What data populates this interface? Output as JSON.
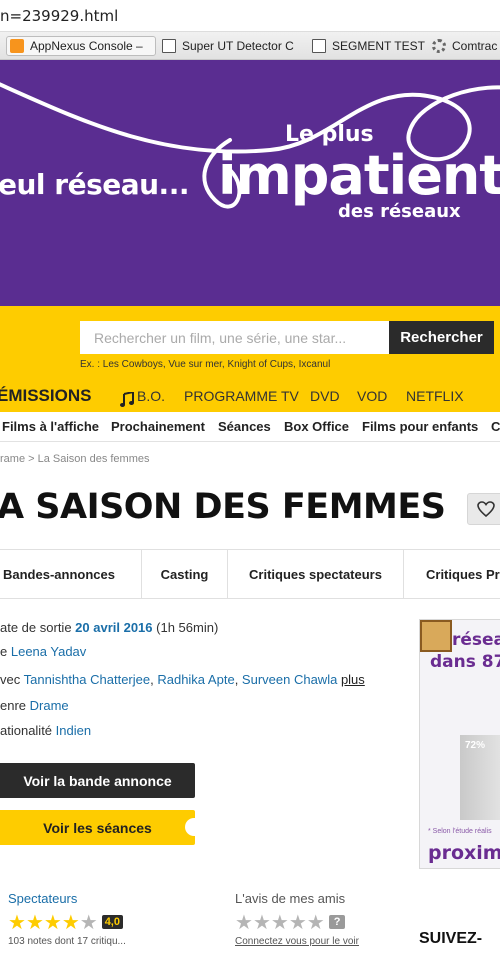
{
  "browser": {
    "url": "n=239929.html",
    "bookmarks": [
      "AppNexus Console –",
      "Super UT Detector C",
      "SEGMENT TEST",
      "Comtrac"
    ]
  },
  "banner": {
    "left_text": "eul réseau...",
    "le_plus": "Le plus",
    "big_word": "impatient",
    "small_text": "des réseaux"
  },
  "search": {
    "placeholder": "Rechercher un film, une série, une star...",
    "button": "Rechercher",
    "examples": "Ex. : Les Cowboys, Vue sur mer, Knight of Cups, Ixcanul"
  },
  "main_nav": [
    "ÉMISSIONS",
    "B.O.",
    "PROGRAMME TV",
    "DVD",
    "VOD",
    "NETFLIX"
  ],
  "sub_nav": [
    "Films à l'affiche",
    "Prochainement",
    "Séances",
    "Box Office",
    "Films pour enfants",
    "C"
  ],
  "breadcrumb": "rame >  La Saison des femmes",
  "movie": {
    "title": "A SAISON DES FEMMES",
    "tabs": [
      "Bandes-annonces",
      "Casting",
      "Critiques spectateurs",
      "Critiques Pr"
    ],
    "release_label": "ate de sortie",
    "release_date": "20 avril 2016",
    "duration": "(1h 56min)",
    "director_label": "e",
    "director": "Leena Yadav",
    "cast_label": "vec",
    "cast": [
      "Tannishtha Chatterjee",
      "Radhika Apte",
      "Surveen Chawla"
    ],
    "cast_more": "plus",
    "genre_label": "enre",
    "genre": "Drame",
    "nationality_label": "ationalité",
    "nationality": "Indien",
    "trailer_button": "Voir la bande annonce",
    "showtimes_button": "Voir les séances"
  },
  "ad": {
    "line1": "réseau",
    "line2": "dans 87%",
    "percent": "72%",
    "note": "* Selon l'étude réalis",
    "brand": "proxim"
  },
  "ratings": {
    "spectators_title": "Spectateurs",
    "spectators_score": "4,0",
    "spectators_stars": 4,
    "spectators_sub": "103 notes dont 17 critiqu...",
    "friends_title": "L'avis de mes amis",
    "friends_score": "?",
    "friends_stars": 0,
    "friends_sub": "Connectez vous pour le voir"
  },
  "follow": "SUIVEZ-",
  "colors": {
    "purple": "#5a2d91",
    "yellow": "#fecc00",
    "link": "#1a6ea8",
    "dark": "#2b2b2b"
  }
}
